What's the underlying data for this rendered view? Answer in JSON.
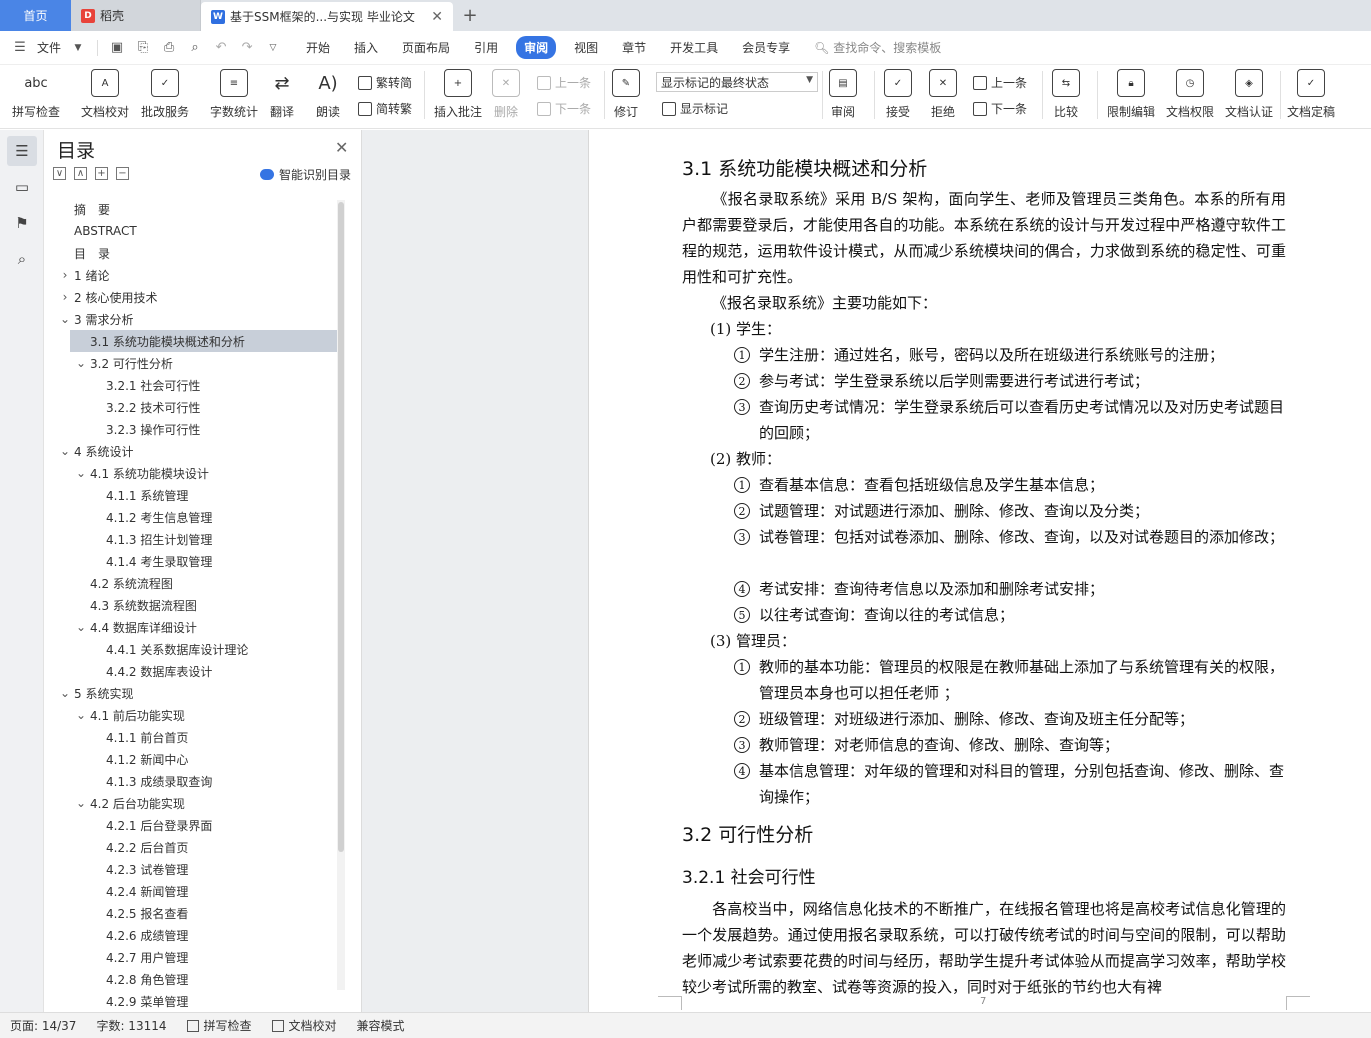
{
  "tabs": {
    "home": "首页",
    "daoke": "稻壳",
    "doc": "基于SSM框架的...与实现 毕业论文",
    "add": "+"
  },
  "menu": {
    "file": "文件",
    "items": [
      "开始",
      "插入",
      "页面布局",
      "引用",
      "审阅",
      "视图",
      "章节",
      "开发工具",
      "会员专享"
    ],
    "active_index": 4,
    "search": "查找命令、搜索模板"
  },
  "ribbon": {
    "spell": "拼写检查",
    "doc_check": "文档校对",
    "review_service": "批改服务",
    "word_count": "字数统计",
    "translate": "翻译",
    "read": "朗读",
    "trad": "繁转简",
    "simp": "简转繁",
    "insert_comment": "插入批注",
    "delete": "删除",
    "prev": "上一条",
    "next": "下一条",
    "revise": "修订",
    "display_state": "显示标记的最终状态",
    "show_marks": "显示标记",
    "review": "审阅",
    "accept": "接受",
    "reject": "拒绝",
    "prev2": "上一条",
    "next2": "下一条",
    "compare": "比较",
    "restrict": "限制编辑",
    "perm": "文档权限",
    "cert": "文档认证",
    "final": "文档定稿"
  },
  "toc": {
    "title": "目录",
    "smart": "智能识别目录",
    "items": [
      {
        "text": "摘　要",
        "level": 0,
        "chev": ""
      },
      {
        "text": "ABSTRACT",
        "level": 0,
        "chev": ""
      },
      {
        "text": "目　录",
        "level": 0,
        "chev": ""
      },
      {
        "text": "1  绪论",
        "level": 0,
        "chev": ">"
      },
      {
        "text": "2  核心使用技术",
        "level": 0,
        "chev": ">"
      },
      {
        "text": "3  需求分析",
        "level": 0,
        "chev": "v"
      },
      {
        "text": "3.1  系统功能模块概述和分析",
        "level": 1,
        "chev": "",
        "selected": true
      },
      {
        "text": "3.2  可行性分析",
        "level": 1,
        "chev": "v"
      },
      {
        "text": "3.2.1  社会可行性",
        "level": 2,
        "chev": ""
      },
      {
        "text": "3.2.2  技术可行性",
        "level": 2,
        "chev": ""
      },
      {
        "text": "3.2.3  操作可行性",
        "level": 2,
        "chev": ""
      },
      {
        "text": "4  系统设计",
        "level": 0,
        "chev": "v"
      },
      {
        "text": "4.1  系统功能模块设计",
        "level": 1,
        "chev": "v"
      },
      {
        "text": "4.1.1  系统管理",
        "level": 2,
        "chev": ""
      },
      {
        "text": "4.1.2  考生信息管理",
        "level": 2,
        "chev": ""
      },
      {
        "text": "4.1.3  招生计划管理",
        "level": 2,
        "chev": ""
      },
      {
        "text": "4.1.4  考生录取管理",
        "level": 2,
        "chev": ""
      },
      {
        "text": "4.2  系统流程图",
        "level": 1,
        "chev": ""
      },
      {
        "text": "4.3  系统数据流程图",
        "level": 1,
        "chev": ""
      },
      {
        "text": "4.4  数据库详细设计",
        "level": 1,
        "chev": "v"
      },
      {
        "text": "4.4.1  关系数据库设计理论",
        "level": 2,
        "chev": ""
      },
      {
        "text": "4.4.2  数据库表设计",
        "level": 2,
        "chev": ""
      },
      {
        "text": "5  系统实现",
        "level": 0,
        "chev": "v"
      },
      {
        "text": "4.1  前后功能实现",
        "level": 1,
        "chev": "v"
      },
      {
        "text": "4.1.1  前台首页",
        "level": 2,
        "chev": ""
      },
      {
        "text": "4.1.2  新闻中心",
        "level": 2,
        "chev": ""
      },
      {
        "text": "4.1.3  成绩录取查询",
        "level": 2,
        "chev": ""
      },
      {
        "text": "4.2  后台功能实现",
        "level": 1,
        "chev": "v"
      },
      {
        "text": "4.2.1  后台登录界面",
        "level": 2,
        "chev": ""
      },
      {
        "text": "4.2.2  后台首页",
        "level": 2,
        "chev": ""
      },
      {
        "text": "4.2.3  试卷管理",
        "level": 2,
        "chev": ""
      },
      {
        "text": "4.2.4  新闻管理",
        "level": 2,
        "chev": ""
      },
      {
        "text": "4.2.5  报名查看",
        "level": 2,
        "chev": ""
      },
      {
        "text": "4.2.6  成绩管理",
        "level": 2,
        "chev": ""
      },
      {
        "text": "4.2.7  用户管理",
        "level": 2,
        "chev": ""
      },
      {
        "text": "4.2.8  角色管理",
        "level": 2,
        "chev": ""
      },
      {
        "text": "4.2.9  菜单管理",
        "level": 2,
        "chev": ""
      }
    ]
  },
  "doc": {
    "h31": "3.1  系统功能模块概述和分析",
    "p1": "《报名录取系统》采用 B/S 架构，面向学生、老师及管理员三类角色。本系的所有用户都需要登录后，才能使用各自的功能。本系统在系统的设计与开发过程中严格遵守软件工程的规范，运用软件设计模式，从而减少系统模块间的偶合，力求做到系统的稳定性、可重用性和可扩充性。",
    "p2": "《报名录取系统》主要功能如下：",
    "s1": "(1) 学生：",
    "s1_items": [
      "学生注册：通过姓名，账号，密码以及所在班级进行系统账号的注册；",
      "参与考试：学生登录系统以后学则需要进行考试进行考试；",
      "查询历史考试情况：学生登录系统后可以查看历史考试情况以及对历史考试题目的回顾；"
    ],
    "s2": "(2) 教师：",
    "s2_items": [
      "查看基本信息：查看包括班级信息及学生基本信息；",
      "试题管理：对试题进行添加、删除、修改、查询以及分类；",
      "试卷管理：包括对试卷添加、删除、修改、查询，以及对试卷题目的添加修改；",
      "考试安排：查询待考信息以及添加和删除考试安排；",
      "以往考试查询：查询以往的考试信息；"
    ],
    "s3": "(3) 管理员：",
    "s3_items": [
      "教师的基本功能：管理员的权限是在教师基础上添加了与系统管理有关的权限，管理员本身也可以担任老师 ；",
      "班级管理：对班级进行添加、删除、修改、查询及班主任分配等；",
      "教师管理：对老师信息的查询、修改、删除、查询等；",
      "基本信息管理：对年级的管理和对科目的管理，分别包括查询、修改、删除、查询操作；"
    ],
    "h32": "3.2  可行性分析",
    "h321": "3.2.1  社会可行性",
    "p3": "各高校当中，网络信息化技术的不断推广，在线报名管理也将是高校考试信息化管理的一个发展趋势。通过使用报名录取系统，可以打破传统考试的时间与空间的限制，可以帮助老师减少考试索要花费的时间与经历，帮助学生提升考试体验从而提高学习效率，帮助学校较少考试所需的教室、试卷等资源的投入，同时对于纸张的节约也大有裨",
    "page_num": "7"
  },
  "status": {
    "page": "页面: 14/37",
    "words": "字数: 13114",
    "spell": "拼写检查",
    "check": "文档校对",
    "compat": "兼容模式"
  }
}
